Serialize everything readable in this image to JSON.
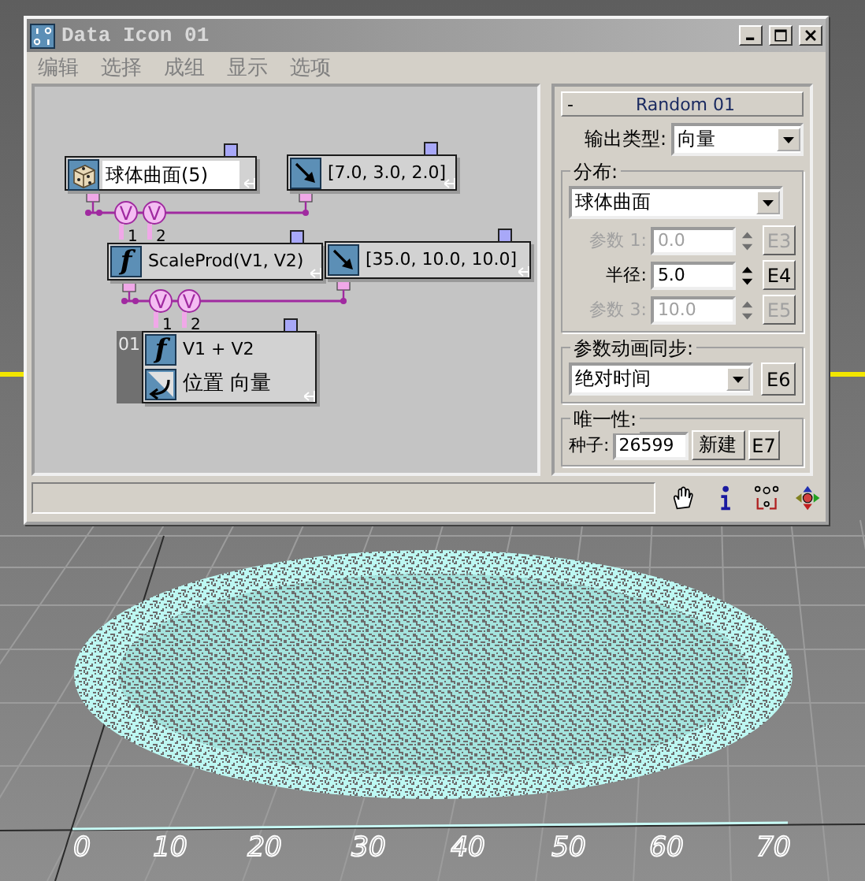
{
  "window": {
    "title": "Data Icon 01"
  },
  "menu": [
    {
      "label": "编辑"
    },
    {
      "label": "选择"
    },
    {
      "label": "成组"
    },
    {
      "label": "显示"
    },
    {
      "label": "选项"
    }
  ],
  "nodes": [
    {
      "kind": "random",
      "label": "球体曲面(5)",
      "selected": true
    },
    {
      "kind": "vector",
      "label": "[7.0, 3.0, 2.0]",
      "selected": false
    },
    {
      "kind": "function",
      "glyph": "f",
      "label": "ScaleProd(V1, V2)",
      "selected": false
    },
    {
      "kind": "vector",
      "label": "[35.0, 10.0, 10.0]",
      "selected": false
    },
    {
      "kind": "output",
      "glyph": "f",
      "index": "01",
      "label": "V1 + V2",
      "sublabel": "位置 向量",
      "selected": false
    }
  ],
  "connectors": [
    {
      "ports": [
        {
          "symbol": "V",
          "number": "1"
        },
        {
          "symbol": "V",
          "number": "2"
        }
      ]
    },
    {
      "ports": [
        {
          "symbol": "V",
          "number": "1"
        },
        {
          "symbol": "V",
          "number": "2"
        }
      ]
    }
  ],
  "panel": {
    "collapse": "-",
    "title": "Random 01",
    "output_type": {
      "label": "输出类型:",
      "value": "向量"
    },
    "distribution": {
      "label": "分布:",
      "value": "球体曲面",
      "params": [
        {
          "label": "参数 1:",
          "value": "0.0",
          "button": "E3",
          "disabled": true
        },
        {
          "label": "半径:",
          "value": "5.0",
          "button": "E4",
          "disabled": false
        },
        {
          "label": "参数 3:",
          "value": "10.0",
          "button": "E5",
          "disabled": true
        }
      ]
    },
    "sync": {
      "label": "参数动画同步:",
      "value": "绝对时间",
      "button": "E6"
    },
    "uniqueness": {
      "label": "唯一性:",
      "seed_label": "种子:",
      "seed": "26599",
      "new_button": "新建",
      "button": "E7"
    }
  },
  "viewport": {
    "axis_labels": [
      "0",
      "10",
      "20",
      "30",
      "40",
      "50",
      "60",
      "70"
    ]
  }
}
